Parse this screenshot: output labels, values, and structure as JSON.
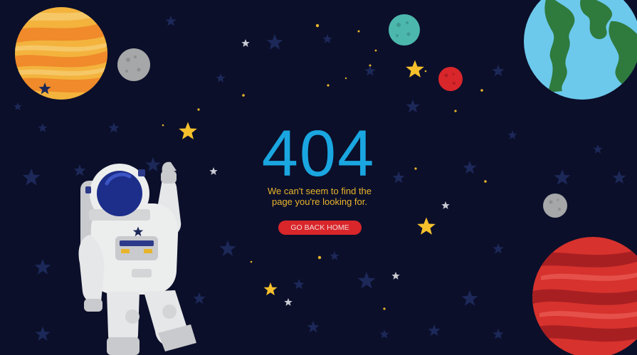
{
  "error_page": {
    "code": "404",
    "message_line1": "We can't seem to find the",
    "message_line2": "page you're looking for.",
    "button_label": "GO BACK HOME"
  },
  "colors": {
    "background": "#0b0f2a",
    "code": "#1aa6e0",
    "message": "#e9b42c",
    "button": "#d8262b",
    "star": "#f5c02c"
  },
  "icons": [
    "astronaut-icon",
    "planet-icon",
    "star-icon",
    "moon-icon"
  ]
}
